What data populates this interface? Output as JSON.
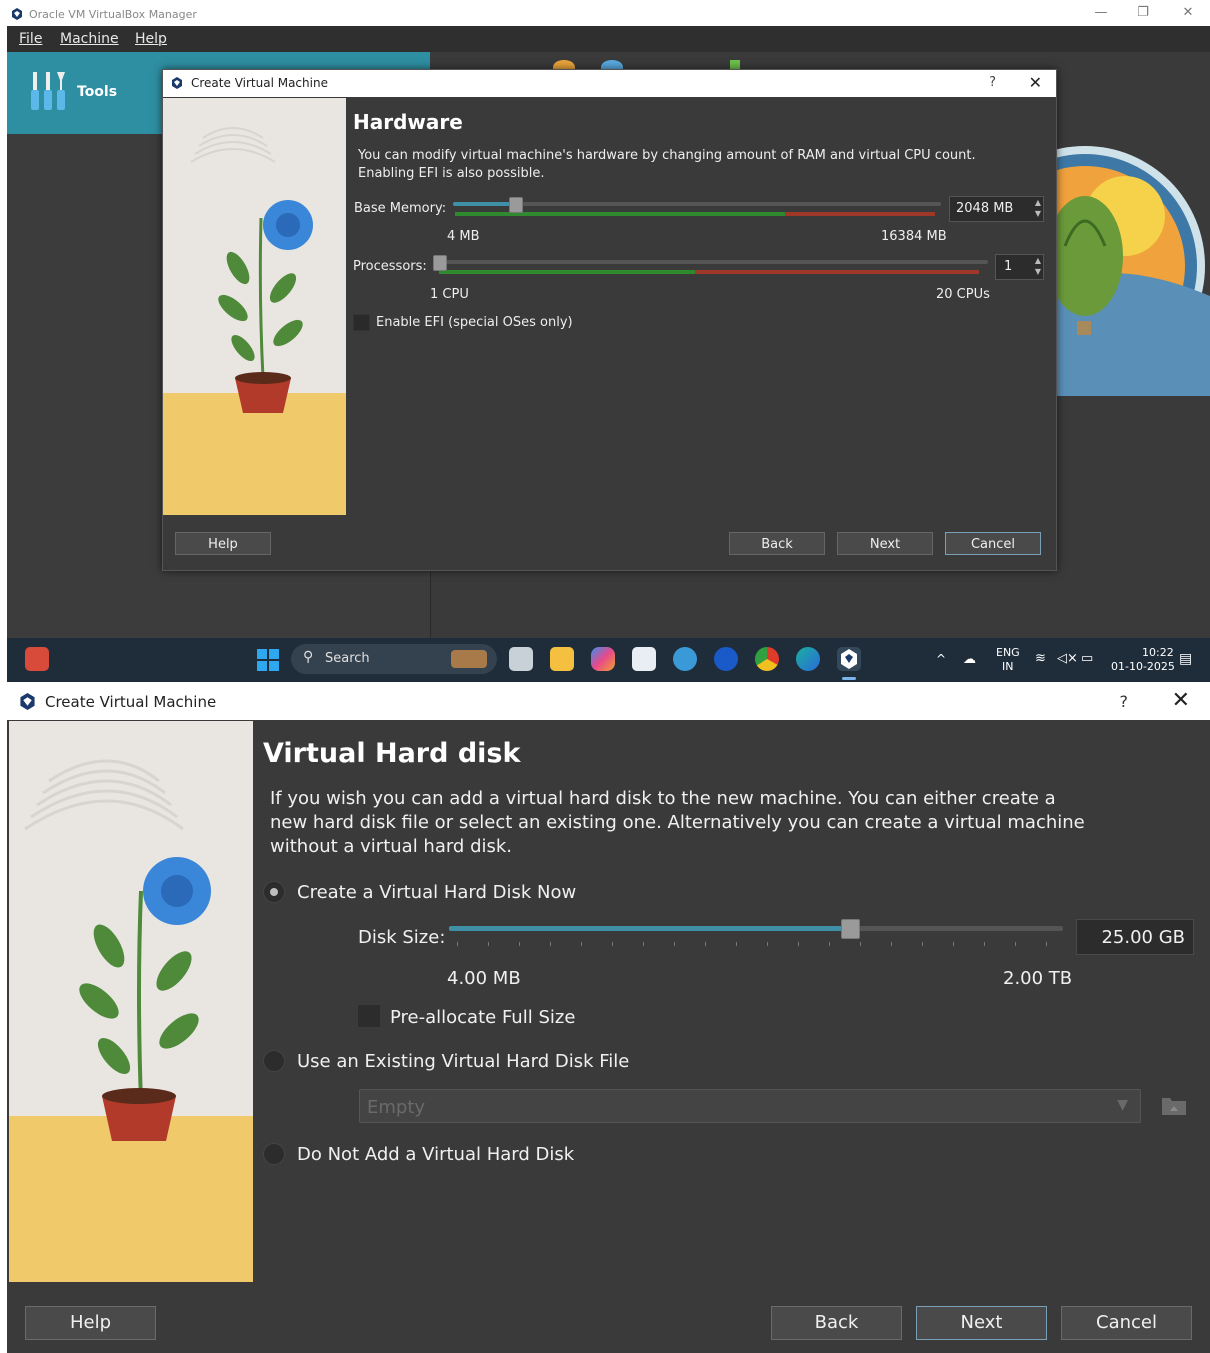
{
  "manager": {
    "window_title": "Oracle VM VirtualBox Manager",
    "menu": [
      "File",
      "Machine",
      "Help"
    ],
    "tools_label": "Tools"
  },
  "dialog_small": {
    "title": "Create Virtual Machine",
    "help_glyph": "?",
    "close_glyph": "✕",
    "heading": "Hardware",
    "description": "You can modify virtual machine's hardware by changing amount of RAM and virtual CPU count. Enabling EFI is also possible.",
    "base_memory": {
      "label": "Base Memory:",
      "value": "2048 MB",
      "min_label": "4 MB",
      "max_label": "16384 MB",
      "fraction": 0.125
    },
    "processors": {
      "label": "Processors:",
      "value": "1",
      "min_label": "1 CPU",
      "max_label": "20 CPUs",
      "fraction": 0.0
    },
    "efi_label": "Enable EFI (special OSes only)",
    "buttons": {
      "help": "Help",
      "back": "Back",
      "next": "Next",
      "cancel": "Cancel"
    }
  },
  "taskbar": {
    "search_placeholder": "Search",
    "lang_top": "ENG",
    "lang_bottom": "IN",
    "time": "10:22",
    "date": "01-10-2025"
  },
  "dialog_large": {
    "title": "Create Virtual Machine",
    "help_glyph": "?",
    "close_glyph": "✕",
    "heading": "Virtual Hard disk",
    "description": "If you wish you can add a virtual hard disk to the new machine. You can either create a new hard disk file or select an existing one. Alternatively you can create a virtual machine without a virtual hard disk.",
    "option_create": "Create a Virtual Hard Disk Now",
    "disk_size": {
      "label": "Disk Size:",
      "value": "25.00 GB",
      "min_label": "4.00 MB",
      "max_label": "2.00 TB",
      "fraction": 0.65
    },
    "preallocate_label": "Pre-allocate Full Size",
    "option_existing": "Use an Existing Virtual Hard Disk File",
    "existing_placeholder": "Empty",
    "option_none": "Do Not Add a Virtual Hard Disk",
    "selected_option": "create",
    "buttons": {
      "help": "Help",
      "back": "Back",
      "next": "Next",
      "cancel": "Cancel"
    }
  }
}
